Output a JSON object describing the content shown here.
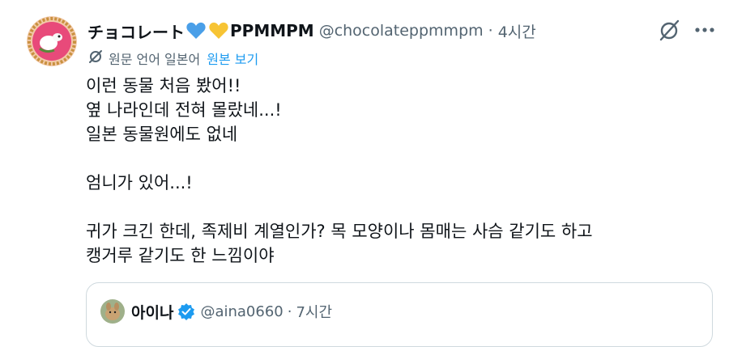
{
  "author": {
    "display_name": "チョコレート",
    "display_name_suffix": "PPMMPM",
    "handle": "@chocolateppmmpm",
    "separator": "·",
    "time": "4시간",
    "heart_colors": [
      "#4a9fe8",
      "#f7c434"
    ]
  },
  "translation": {
    "icon": "translate-icon",
    "note": "원문 언어 일본어",
    "show_original": "원본 보기"
  },
  "tweet": {
    "lines": [
      "이런 동물 처음 봤어!!",
      "옆 나라인데 전혀 몰랐네...!",
      "일본 동물원에도 없네",
      "",
      "엄니가 있어...!",
      "",
      "귀가 크긴 한데, 족제비 계열인가? 목 모양이나 몸매는 사슴 같기도 하고",
      "캥거루 같기도 한 느낌이야"
    ]
  },
  "quote": {
    "display_name": "아이나",
    "handle": "@aina0660",
    "separator": "·",
    "time": "7시간",
    "verified_color": "#1d9bf0"
  },
  "colors": {
    "text": "#0f1419",
    "secondary": "#536471",
    "link": "#1d9bf0",
    "border": "#cfd9de"
  },
  "icons": [
    "grok-icon",
    "more-icon",
    "translate-icon",
    "verified-badge-icon",
    "heart-icon"
  ]
}
